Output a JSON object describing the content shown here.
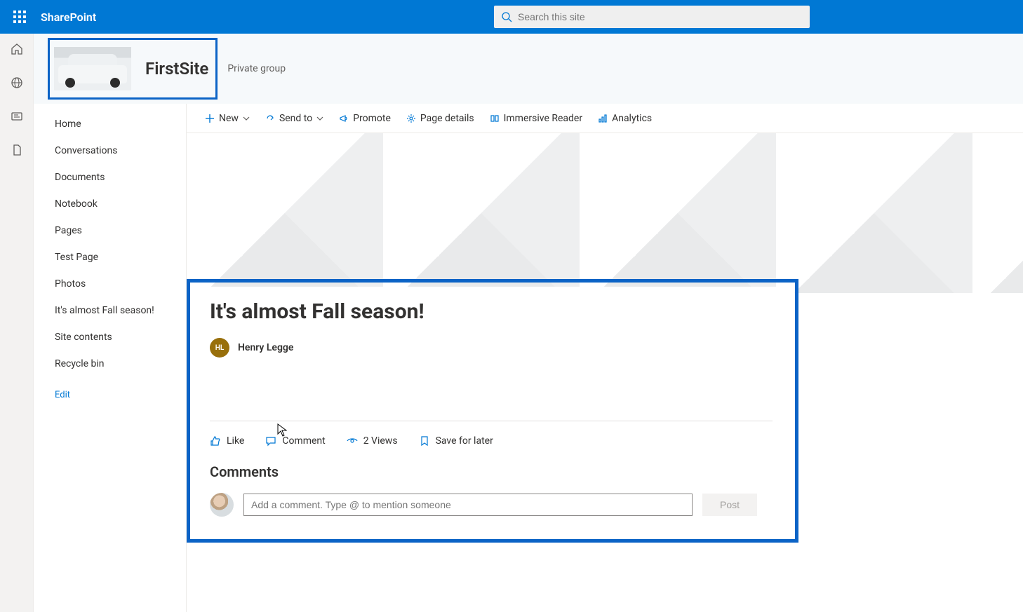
{
  "suite": {
    "title": "SharePoint"
  },
  "search": {
    "placeholder": "Search this site"
  },
  "site": {
    "name": "FirstSite",
    "privacy": "Private group"
  },
  "nav": {
    "items": [
      "Home",
      "Conversations",
      "Documents",
      "Notebook",
      "Pages",
      "Test Page",
      "Photos",
      "It's almost Fall season!",
      "Site contents",
      "Recycle bin"
    ],
    "edit": "Edit"
  },
  "commands": {
    "new": "New",
    "send_to": "Send to",
    "promote": "Promote",
    "page_details": "Page details",
    "immersive": "Immersive Reader",
    "analytics": "Analytics"
  },
  "article": {
    "title": "It's almost Fall season!",
    "author_initials": "HL",
    "author": "Henry Legge",
    "like": "Like",
    "comment": "Comment",
    "views": "2 Views",
    "save": "Save for later",
    "comments_heading": "Comments",
    "comment_placeholder": "Add a comment. Type @ to mention someone",
    "post": "Post"
  }
}
